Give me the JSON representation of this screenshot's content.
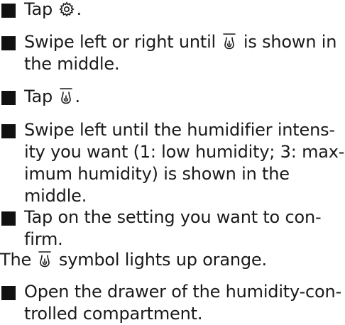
{
  "steps": [
    {
      "lines": [
        {
          "pre": "Tap ",
          "icon": "gear-icon",
          "post": "."
        }
      ]
    },
    {
      "lines": [
        {
          "pre": "Swipe left or right until ",
          "icon": "humidity-icon",
          "post": " is shown in"
        },
        {
          "text": "the middle."
        }
      ]
    },
    {
      "lines": [
        {
          "pre": "Tap ",
          "icon": "humidity-icon",
          "post": "."
        }
      ]
    },
    {
      "lines": [
        {
          "text": "Swipe left until the humidifier intens-"
        },
        {
          "text": "ity you want (1: low humidity; 3: max-"
        },
        {
          "text": "imum humidity) is shown in the"
        },
        {
          "text": "middle."
        }
      ]
    },
    {
      "lines": [
        {
          "text": "Tap on the setting you want to con-"
        },
        {
          "text": "firm."
        }
      ]
    }
  ],
  "result": {
    "pre": "The ",
    "icon": "humidity-icon",
    "post": " symbol lights up orange."
  },
  "final_step": {
    "lines": [
      {
        "text": "Open the drawer of the humidity-con-"
      },
      {
        "text": "trolled compartment."
      }
    ]
  }
}
